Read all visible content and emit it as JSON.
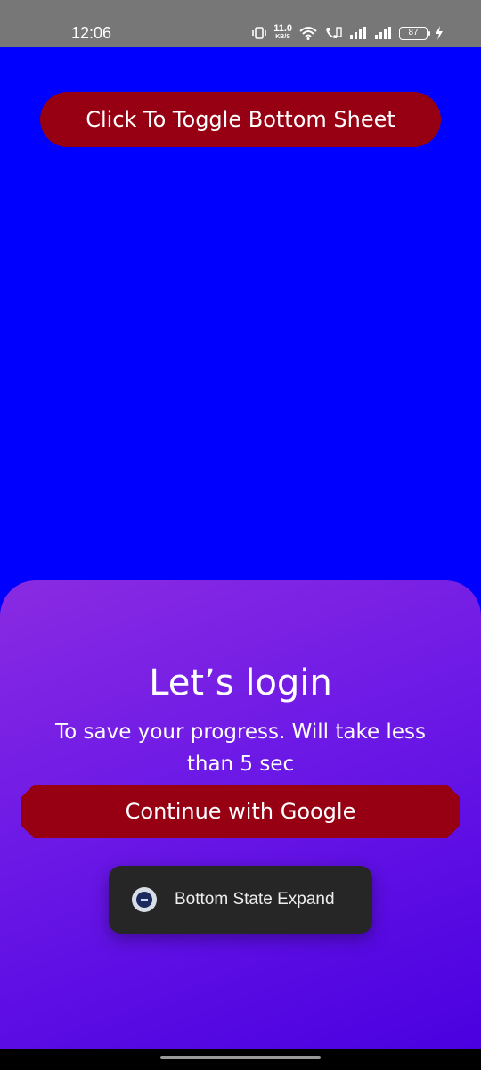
{
  "status_bar": {
    "time": "12:06",
    "net_speed_value": "11.0",
    "net_speed_unit": "KB/S",
    "battery_level": "87",
    "icons": [
      "vibrate-icon",
      "wifi-icon",
      "volte-icon",
      "signal-icon",
      "signal-icon",
      "battery-icon",
      "charging-icon"
    ]
  },
  "main": {
    "background_color": "#0000ff",
    "toggle_button_label": "Click To Toggle Bottom Sheet"
  },
  "bottom_sheet": {
    "title": "Let’s login",
    "subtitle": "To save your progress. Will take less than 5 sec",
    "google_button_label": "Continue with Google",
    "button_color": "#960012"
  },
  "toast": {
    "text": "Bottom State Expand",
    "icon": "app-icon"
  }
}
